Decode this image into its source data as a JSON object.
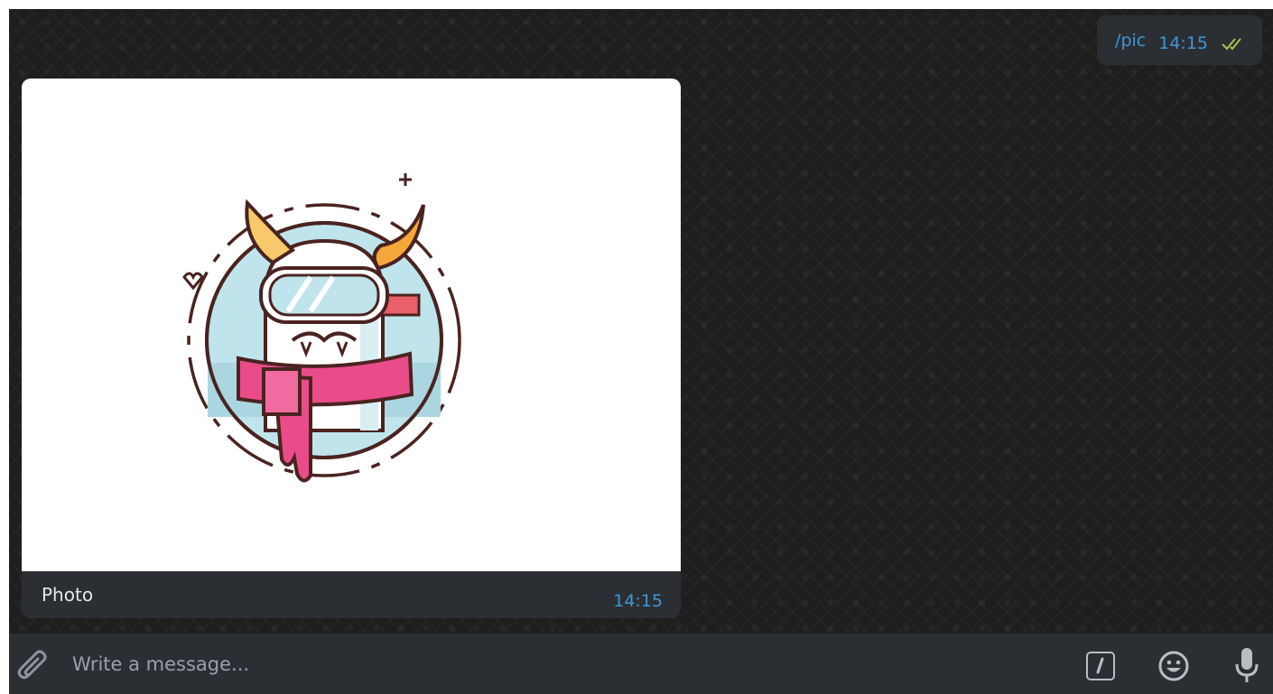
{
  "chat": {
    "outgoing": {
      "text": "/pic",
      "time": "14:15",
      "status_icon": "double-check-icon"
    },
    "incoming": {
      "caption": "Photo",
      "time": "14:15",
      "media": "monster-illustration"
    }
  },
  "composer": {
    "placeholder": "Write a message...",
    "icons": [
      "paperclip-icon",
      "bot-command-icon",
      "emoji-icon",
      "microphone-icon"
    ]
  },
  "colors": {
    "chat_bg": "#1e1e1e",
    "bubble_bg": "#2b2f33",
    "link_blue": "#3e97d6",
    "tick_green": "#a7c44f",
    "scarf_pink": "#e94c88",
    "horn_orange": "#f6a73a",
    "sky_blue": "#bfe4ec"
  }
}
